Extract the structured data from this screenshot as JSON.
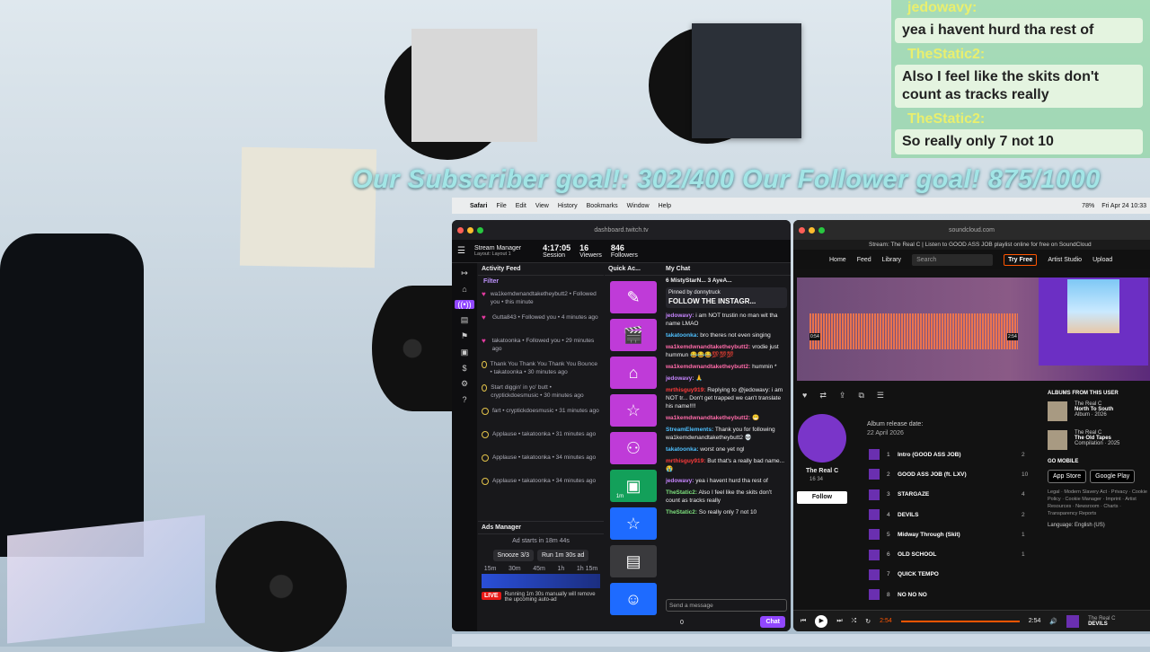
{
  "overlay": {
    "goals": "Our Subscriber goal!: 302/400  Our Follower goal! 875/1000",
    "chat": [
      {
        "user": "jedowavy:",
        "msg": "yea i havent hurd tha rest of"
      },
      {
        "user": "TheStatic2:",
        "msg": "Also I feel like the skits don't count as tracks really"
      },
      {
        "user": "TheStatic2:",
        "msg": "So really only 7 not 10"
      }
    ]
  },
  "menubar": {
    "app": "Safari",
    "items": [
      "File",
      "Edit",
      "View",
      "History",
      "Bookmarks",
      "Window",
      "Help"
    ],
    "battery": "78%",
    "datetime": "Fri Apr 24 10:33"
  },
  "twitch": {
    "url": "dashboard.twitch.tv",
    "title": "Stream Manager",
    "layout": "Layout: Layout 1",
    "session": {
      "value": "4:17:05",
      "label": "Session"
    },
    "viewers": {
      "value": "16",
      "label": "Viewers"
    },
    "followers": {
      "value": "846",
      "label": "Followers"
    },
    "activity_title": "Activity Feed",
    "filter": "Filter",
    "feed": [
      {
        "kind": "follow",
        "text": "wa1kemdwnandtaketheybutt2 • Followed you • this minute"
      },
      {
        "kind": "follow",
        "text": "Gutta843 • Followed you • 4 minutes ago"
      },
      {
        "kind": "follow",
        "text": "takatoonka • Followed you • 29 minutes ago"
      },
      {
        "kind": "alert",
        "text": "Thank You Thank You Thank You Bounce • takatoonka • 30 minutes ago"
      },
      {
        "kind": "alert",
        "text": "Start diggin' in yo' butt • cryptickdoesmusic • 30 minutes ago"
      },
      {
        "kind": "alert",
        "text": "fart • cryptickdoesmusic • 31 minutes ago"
      },
      {
        "kind": "alert",
        "text": "Applause • takatoonka • 31 minutes ago"
      },
      {
        "kind": "alert",
        "text": "Applause • takatoonka • 34 minutes ago"
      },
      {
        "kind": "alert",
        "text": "Applause • takatoonka • 34 minutes ago"
      }
    ],
    "ads_title": "Ads Manager",
    "ads_starts": "Ad starts in  18m 44s",
    "snooze": "Snooze 3/3",
    "run_ad": "Run 1m 30s ad",
    "ad_ticks": [
      "15m",
      "30m",
      "45m",
      "1h",
      "1h 15m"
    ],
    "live": "LIVE",
    "ad_note": "Running 1m 30s manually will remove the upcoming auto-ad",
    "quick_title": "Quick Ac...",
    "quick_icons": [
      "edit-icon",
      "clapper-icon",
      "mushroom-icon",
      "star-icon",
      "add-friend-icon",
      "ad-icon",
      "star-icon",
      "list-icon",
      "smile-icon"
    ],
    "quick_badge": "1m",
    "chat_title": "My Chat",
    "chat_tabs": "6   MistyStarN...  3   AyeA...",
    "pinned_by": "Pinned by donnytruck",
    "pinned_msg": "FOLLOW THE INSTAGR...",
    "messages": [
      {
        "u": "jedowavy:",
        "c": "u1",
        "m": "i am NOT trustin no man wit tha name LMAO"
      },
      {
        "u": "takatoonka:",
        "c": "u3",
        "m": "bro theres not even singing"
      },
      {
        "u": "wa1kemdwnandtaketheybutt2:",
        "c": "u2",
        "m": "vrodie just hummun 😂😂😂💯💯💯"
      },
      {
        "u": "wa1kemdwnandtaketheybutt2:",
        "c": "u2",
        "m": "hummin *"
      },
      {
        "u": "jedowavy:",
        "c": "u1",
        "m": "🙏"
      },
      {
        "u": "mrthisguy919:",
        "c": "u4",
        "m": "Replying to @jedowavy: i am NOT tr... Don't get trapped we can't translate his name!!!!"
      },
      {
        "u": "wa1kemdwnandtaketheybutt2:",
        "c": "u2",
        "m": "😁"
      },
      {
        "u": "StreamElements:",
        "c": "u3",
        "m": "Thank you for following wa1kemdwnandtaketheybutt2 💀"
      },
      {
        "u": "takatoonka:",
        "c": "u3",
        "m": "worst one yet ngl"
      },
      {
        "u": "mrthisguy919:",
        "c": "u4",
        "m": "But that's a really bad name... 😭"
      },
      {
        "u": "jedowavy:",
        "c": "u1",
        "m": "yea i havent hurd tha rest of"
      },
      {
        "u": "TheStatic2:",
        "c": "u5",
        "m": "Also I feel like the skits don't count as tracks really"
      },
      {
        "u": "TheStatic2:",
        "c": "u5",
        "m": "So really only 7 not 10"
      }
    ],
    "chat_placeholder": "Send a message",
    "chat_button": "Chat",
    "points": "0"
  },
  "soundcloud": {
    "url": "soundcloud.com",
    "tab_title": "Stream: The Real C | Listen to GOOD ASS JOB playlist online for free on SoundCloud",
    "nav": [
      "Home",
      "Feed",
      "Library"
    ],
    "search_placeholder": "Search",
    "try_free": "Try Free",
    "artist_studio": "Artist Studio",
    "upload": "Upload",
    "time_start": "0:54",
    "time_end": "2:54",
    "artist": "The Real C",
    "artist_stats": "16   34",
    "follow": "Follow",
    "release_label": "Album release date:",
    "release_date": "22 April 2026",
    "tracks": [
      {
        "n": "1",
        "name": "Intro (GOOD ASS JOB)",
        "plays": "2"
      },
      {
        "n": "2",
        "name": "GOOD ASS JOB (ft. LXV)",
        "plays": "10"
      },
      {
        "n": "3",
        "name": "STARGAZE",
        "plays": "4"
      },
      {
        "n": "4",
        "name": "DEVILS",
        "plays": "2"
      },
      {
        "n": "5",
        "name": "Midway Through (Skit)",
        "plays": "1"
      },
      {
        "n": "6",
        "name": "OLD SCHOOL",
        "plays": "1"
      },
      {
        "n": "7",
        "name": "QUICK TEMPO",
        "plays": ""
      },
      {
        "n": "8",
        "name": "NO NO NO",
        "plays": ""
      }
    ],
    "albums_title": "ALBUMS FROM THIS USER",
    "albums": [
      {
        "artist": "The Real C",
        "title": "North To South",
        "meta": "Album · 2026"
      },
      {
        "artist": "The Real C",
        "title": "The Old Tapes",
        "meta": "Compilation · 2025"
      }
    ],
    "go_mobile": "GO MOBILE",
    "app_store": "App Store",
    "google_play": "Google Play",
    "footer": "Legal · Modern Slavery Act · Privacy · Cookie Policy · Cookie Manager · Imprint · Artist Resources · Newsroom · Charts · Transparency Reports",
    "language": "Language: English (US)",
    "player_pos": "2:54",
    "player_dur": "2:54",
    "now_artist": "The Real C",
    "now_title": "DEVILS",
    "progress": 1.0
  }
}
